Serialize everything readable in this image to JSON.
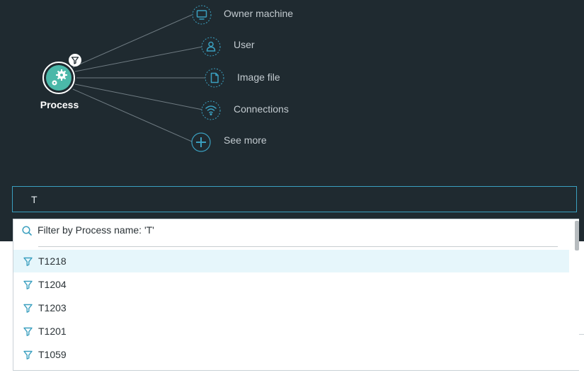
{
  "graph": {
    "process_label": "Process",
    "nodes": [
      {
        "id": "owner-machine",
        "label": "Owner machine",
        "icon": "monitor-icon"
      },
      {
        "id": "user",
        "label": "User",
        "icon": "user-icon"
      },
      {
        "id": "image-file",
        "label": "Image file",
        "icon": "file-icon"
      },
      {
        "id": "connections",
        "label": "Connections",
        "icon": "wifi-icon"
      },
      {
        "id": "see-more",
        "label": "See more",
        "icon": "plus-icon"
      }
    ]
  },
  "search": {
    "value": "T"
  },
  "dropdown": {
    "filter_text": "Filter by Process name: 'T'",
    "options": [
      {
        "label": "T1218",
        "selected": true
      },
      {
        "label": "T1204",
        "selected": false
      },
      {
        "label": "T1203",
        "selected": false
      },
      {
        "label": "T1201",
        "selected": false
      },
      {
        "label": "T1059",
        "selected": false
      }
    ]
  },
  "colors": {
    "background_dark": "#1f2a30",
    "accent": "#3a9fbf",
    "process_node": "#4bb8a9",
    "selected_row": "#e6f6fb"
  }
}
